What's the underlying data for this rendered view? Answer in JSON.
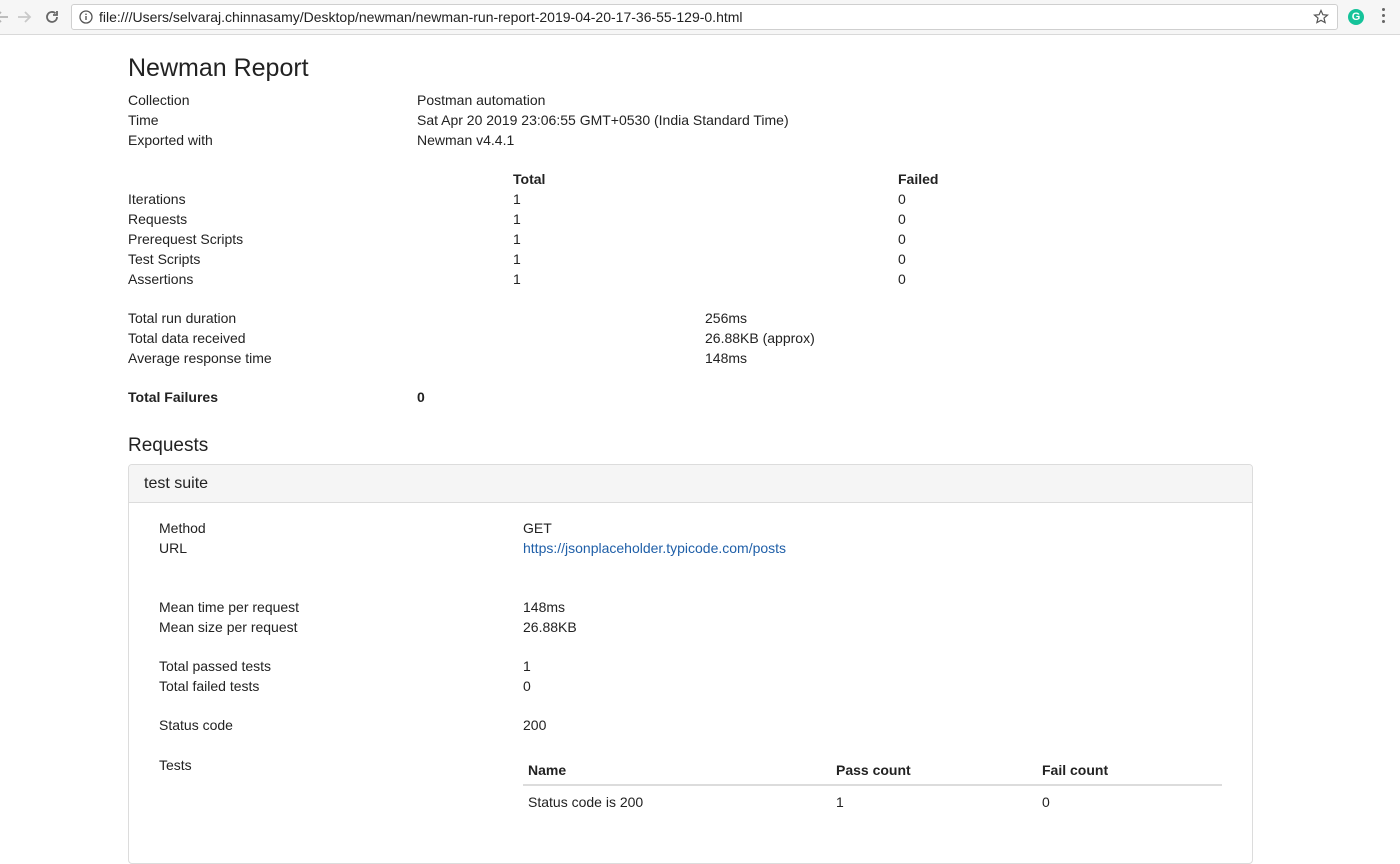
{
  "browser": {
    "url": "file:///Users/selvaraj.chinnasamy/Desktop/newman/newman-run-report-2019-04-20-17-36-55-129-0.html",
    "extension_letter": "G",
    "extension_color": "#15c39a"
  },
  "report": {
    "title": "Newman Report",
    "info": [
      {
        "label": "Collection",
        "value": "Postman automation"
      },
      {
        "label": "Time",
        "value": "Sat Apr 20 2019 23:06:55 GMT+0530 (India Standard Time)"
      },
      {
        "label": "Exported with",
        "value": "Newman v4.4.1"
      }
    ],
    "summary": {
      "headers": {
        "total": "Total",
        "failed": "Failed"
      },
      "rows": [
        {
          "label": "Iterations",
          "total": "1",
          "failed": "0"
        },
        {
          "label": "Requests",
          "total": "1",
          "failed": "0"
        },
        {
          "label": "Prerequest Scripts",
          "total": "1",
          "failed": "0"
        },
        {
          "label": "Test Scripts",
          "total": "1",
          "failed": "0"
        },
        {
          "label": "Assertions",
          "total": "1",
          "failed": "0"
        }
      ]
    },
    "timings": [
      {
        "label": "Total run duration",
        "value": "256ms"
      },
      {
        "label": "Total data received",
        "value": "26.88KB (approx)"
      },
      {
        "label": "Average response time",
        "value": "148ms"
      }
    ],
    "failures": {
      "label": "Total Failures",
      "value": "0"
    },
    "requests_heading": "Requests",
    "request": {
      "name": "test suite",
      "method_label": "Method",
      "method": "GET",
      "url_label": "URL",
      "url": "https://jsonplaceholder.typicode.com/posts",
      "mean_time_label": "Mean time per request",
      "mean_time": "148ms",
      "mean_size_label": "Mean size per request",
      "mean_size": "26.88KB",
      "passed_label": "Total passed tests",
      "passed": "1",
      "failed_label": "Total failed tests",
      "failed": "0",
      "status_label": "Status code",
      "status": "200",
      "tests_label": "Tests",
      "tests_table": {
        "headers": {
          "name": "Name",
          "pass": "Pass count",
          "fail": "Fail count"
        },
        "rows": [
          {
            "name": "Status code is 200",
            "pass": "1",
            "fail": "0"
          }
        ]
      }
    },
    "link_color": "#1f5fa8"
  }
}
